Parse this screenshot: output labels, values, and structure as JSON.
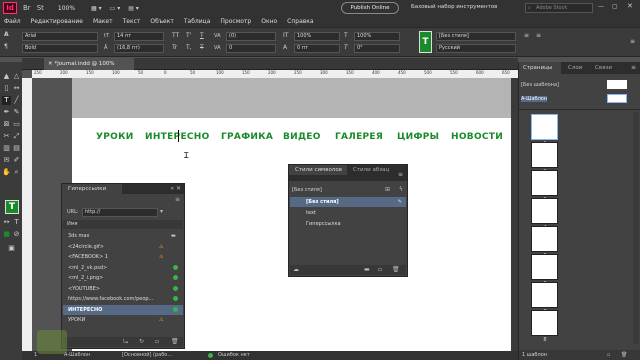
{
  "app": {
    "logo": "Id",
    "zoom": "100%",
    "publish_label": "Publish Online",
    "workspace": "Базовый набор инструментов",
    "search_placeholder": "Adobe Stock"
  },
  "menu": [
    "Файл",
    "Редактирование",
    "Макет",
    "Текст",
    "Объект",
    "Таблица",
    "Просмотр",
    "Окно",
    "Справка"
  ],
  "control": {
    "font": "Arial",
    "style": "Bold",
    "size": "14 пт",
    "leading": "(16,8 пт)",
    "tracking": "(0)",
    "kerning": "0",
    "hscale": "100%",
    "vscale": "100%",
    "baseline": "0 пт",
    "skew": "0°",
    "char_style": "[Без стиля]",
    "language": "Русский",
    "tt1": "TT",
    "tt2": "T'",
    "tt3": "T,",
    "tt4": "T",
    "tt5": "Tr",
    "tt6": "T"
  },
  "doc": {
    "tab": "*Journal.indd @ 100%",
    "ruler": [
      "250",
      "200",
      "150",
      "100",
      "50",
      "0",
      "50",
      "100",
      "150",
      "200",
      "250",
      "300",
      "350",
      "400",
      "450",
      "500",
      "550",
      "600",
      "650"
    ]
  },
  "nav_items": [
    "УРОКИ",
    "ИНТЕРЕСНО",
    "ГРАФИКА",
    "ВИДЕО",
    "ГАЛЕРЕЯ",
    "ЦИФРЫ",
    "НОВОСТИ"
  ],
  "hyperlinks": {
    "title": "Гиперссылки",
    "url_label": "URL:",
    "url_value": "http://",
    "col_name": "Имя",
    "items": [
      {
        "name": "3ds max",
        "status": "icon"
      },
      {
        "name": "<24circle.gif>",
        "status": "warn"
      },
      {
        "name": "<FACEBOOK> 1",
        "status": "warn"
      },
      {
        "name": "<ml_2_vk.psd>",
        "status": "ok"
      },
      {
        "name": "<ml_2_i.png>",
        "status": "ok"
      },
      {
        "name": "<YOUTUBE>",
        "status": "ok"
      },
      {
        "name": "https://www.facebook.com/peop...",
        "status": "ok"
      },
      {
        "name": "ИНТЕРЕСНО",
        "status": "ok"
      },
      {
        "name": "УРОКИ",
        "status": "warn"
      }
    ],
    "selected_index": 7
  },
  "char_styles": {
    "title": "Стили символов",
    "tab2": "Стили абзац",
    "current": "[Без стиля]",
    "items": [
      "[Без стиля]",
      "text",
      "Гиперссылка"
    ],
    "selected_index": 0
  },
  "pages": {
    "tabs": [
      "Страницы",
      "Слои",
      "Связи"
    ],
    "none_master": "[Без шаблона]",
    "master": "A-Шаблон",
    "page_numbers": [
      "1",
      "2",
      "3",
      "4",
      "5",
      "6",
      "7",
      "8",
      "9"
    ],
    "footer": "1 шаблон"
  },
  "status": {
    "page_num": "1",
    "master_sel": "A-Шаблон",
    "layout": "[Основной] (рабо...",
    "preflight": "Ошибок нет"
  },
  "colors": {
    "accent": "#1a8a2a",
    "selection": "#566a86",
    "status_ok": "#39b34a",
    "status_warn": "#f0a030"
  }
}
